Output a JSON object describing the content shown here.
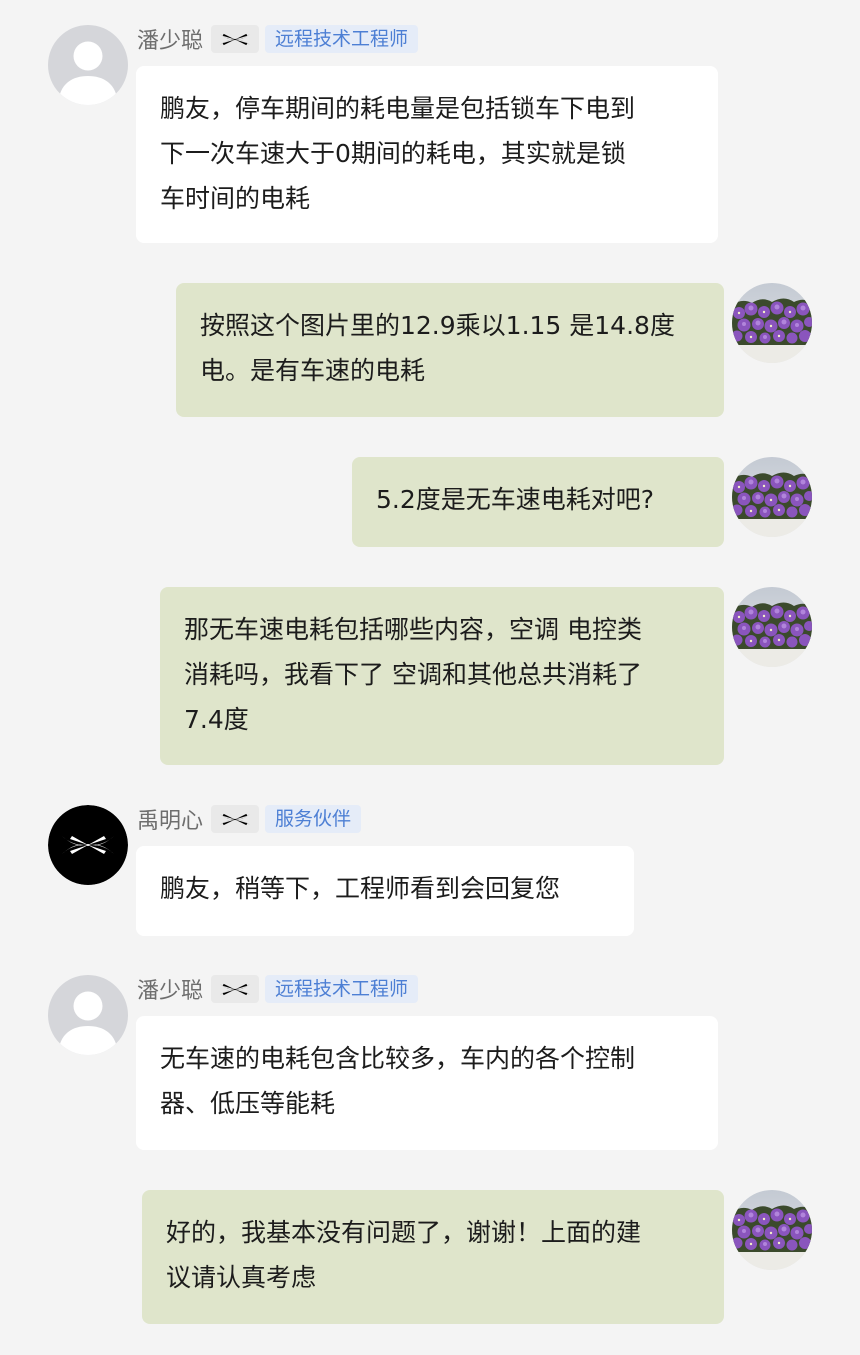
{
  "colors": {
    "background": "#f4f4f4",
    "incoming_bubble": "#ffffff",
    "outgoing_bubble": "#dfe5cb",
    "role_badge_text": "#4d7fd4",
    "role_badge_bg": "#e5ecf8"
  },
  "messages": [
    {
      "direction": "incoming",
      "sender": "潘少聪",
      "badge_icon": "brand-x-logo",
      "role": "远程技术工程师",
      "avatar": "default-user-avatar",
      "lines": [
        "鹏友，停车期间的耗电量是包括锁车下电到",
        "下一次车速大于0期间的耗电，其实就是锁",
        "车时间的电耗"
      ]
    },
    {
      "direction": "outgoing",
      "avatar": "purple-flowers-avatar",
      "lines": [
        "按照这个图片里的12.9乘以1.15 是14.8度",
        "电。是有车速的电耗"
      ]
    },
    {
      "direction": "outgoing",
      "avatar": "purple-flowers-avatar",
      "lines": [
        "5.2度是无车速电耗对吧?"
      ]
    },
    {
      "direction": "outgoing",
      "avatar": "purple-flowers-avatar",
      "lines": [
        "那无车速电耗包括哪些内容，空调 电控类",
        "消耗吗，我看下了 空调和其他总共消耗了",
        "7.4度"
      ]
    },
    {
      "direction": "incoming",
      "sender": "禹明心",
      "badge_icon": "brand-x-logo",
      "role": "服务伙伴",
      "avatar": "brand-x-avatar",
      "lines": [
        "鹏友，稍等下，工程师看到会回复您"
      ]
    },
    {
      "direction": "incoming",
      "sender": "潘少聪",
      "badge_icon": "brand-x-logo",
      "role": "远程技术工程师",
      "avatar": "default-user-avatar",
      "lines": [
        "无车速的电耗包含比较多，车内的各个控制",
        "器、低压等能耗"
      ]
    },
    {
      "direction": "outgoing",
      "avatar": "purple-flowers-avatar",
      "lines": [
        "好的，我基本没有问题了，谢谢！上面的建",
        "议请认真考虑"
      ]
    }
  ]
}
